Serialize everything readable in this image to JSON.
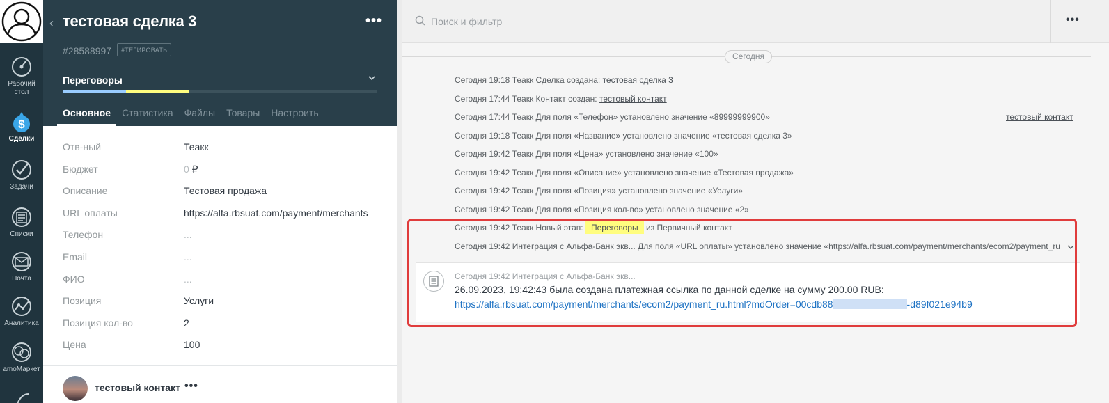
{
  "rail": {
    "items": [
      {
        "label_1": "Рабочий",
        "label_2": "стол",
        "icon": "dashboard-icon"
      },
      {
        "label": "Сделки",
        "icon": "deals-dollar-icon",
        "active": true
      },
      {
        "label": "Задачи",
        "icon": "check-icon"
      },
      {
        "label": "Списки",
        "icon": "list-icon"
      },
      {
        "label": "Почта",
        "icon": "mail-icon"
      },
      {
        "label": "Аналитика",
        "icon": "analytics-icon"
      },
      {
        "label": "amoМаркет",
        "icon": "market-icon"
      }
    ]
  },
  "deal": {
    "title": "тестовая сделка 3",
    "id": "#28588997",
    "tag_button": "#ТЕГИРОВАТЬ",
    "more": "•••",
    "stage": "Переговоры",
    "stage_colors": [
      "#99ccff",
      "#fffd7f"
    ],
    "tabs": [
      "Основное",
      "Статистика",
      "Файлы",
      "Товары",
      "Настроить"
    ],
    "fields": [
      {
        "label": "Отв-ный",
        "value": "Теакк"
      },
      {
        "label": "Бюджет",
        "value": "0",
        "suffix": " ₽"
      },
      {
        "label": "Описание",
        "value": "Тестовая продажа"
      },
      {
        "label": "URL оплаты",
        "value": "https://alfa.rbsuat.com/payment/merchants"
      },
      {
        "label": "Телефон",
        "value": "..."
      },
      {
        "label": "Email",
        "value": "..."
      },
      {
        "label": "ФИО",
        "value": "..."
      },
      {
        "label": "Позиция",
        "value": "Услуги"
      },
      {
        "label": "Позиция кол-во",
        "value": "2"
      },
      {
        "label": "Цена",
        "value": "100"
      }
    ],
    "contact": {
      "name": "тестовый контакт",
      "more": "•••"
    }
  },
  "feed": {
    "search_placeholder": "Поиск и фильтр",
    "more": "•••",
    "date_divider": "Сегодня",
    "events": [
      {
        "text": "Сегодня 19:18 Теакк Сделка создана: ",
        "link": "тестовая сделка 3"
      },
      {
        "text": "Сегодня 17:44 Теакк Контакт создан: ",
        "link": "тестовый контакт"
      },
      {
        "text": "Сегодня 17:44 Теакк Для поля «Телефон» установлено значение «89999999900»",
        "right_link": "тестовый контакт"
      },
      {
        "text": "Сегодня 19:18 Теакк Для поля «Название» установлено значение «тестовая сделка 3»"
      },
      {
        "text": "Сегодня 19:42 Теакк Для поля «Цена» установлено значение «100»"
      },
      {
        "text": "Сегодня 19:42 Теакк Для поля «Описание» установлено значение «Тестовая продажа»"
      },
      {
        "text": "Сегодня 19:42 Теакк Для поля «Позиция» установлено значение «Услуги»"
      },
      {
        "text": "Сегодня 19:42 Теакк Для поля «Позиция кол-во» установлено значение «2»"
      },
      {
        "text": "Сегодня 19:42 Теакк Новый этап: ",
        "stage": "Переговоры",
        "after": " из Первичный контакт"
      },
      {
        "text": "Сегодня 19:42 Интеграция с Альфа-Банк экв... Для поля «URL оплаты» установлено значение «https://alfa.rbsuat.com/payment/merchants/ecom2/payment_ru"
      }
    ],
    "note": {
      "meta": "Сегодня 19:42 Интеграция с Альфа-Банк экв...",
      "text": "26.09.2023, 19:42:43 была создана платежная ссылка по данной сделке на сумму 200.00 RUB:",
      "link_start": "https://alfa.rbsuat.com/payment/merchants/ecom2/payment_ru.html?mdOrder=00cdb88",
      "link_end": "-d89f021e94b9"
    },
    "highlight_color": "#e03c3c"
  }
}
